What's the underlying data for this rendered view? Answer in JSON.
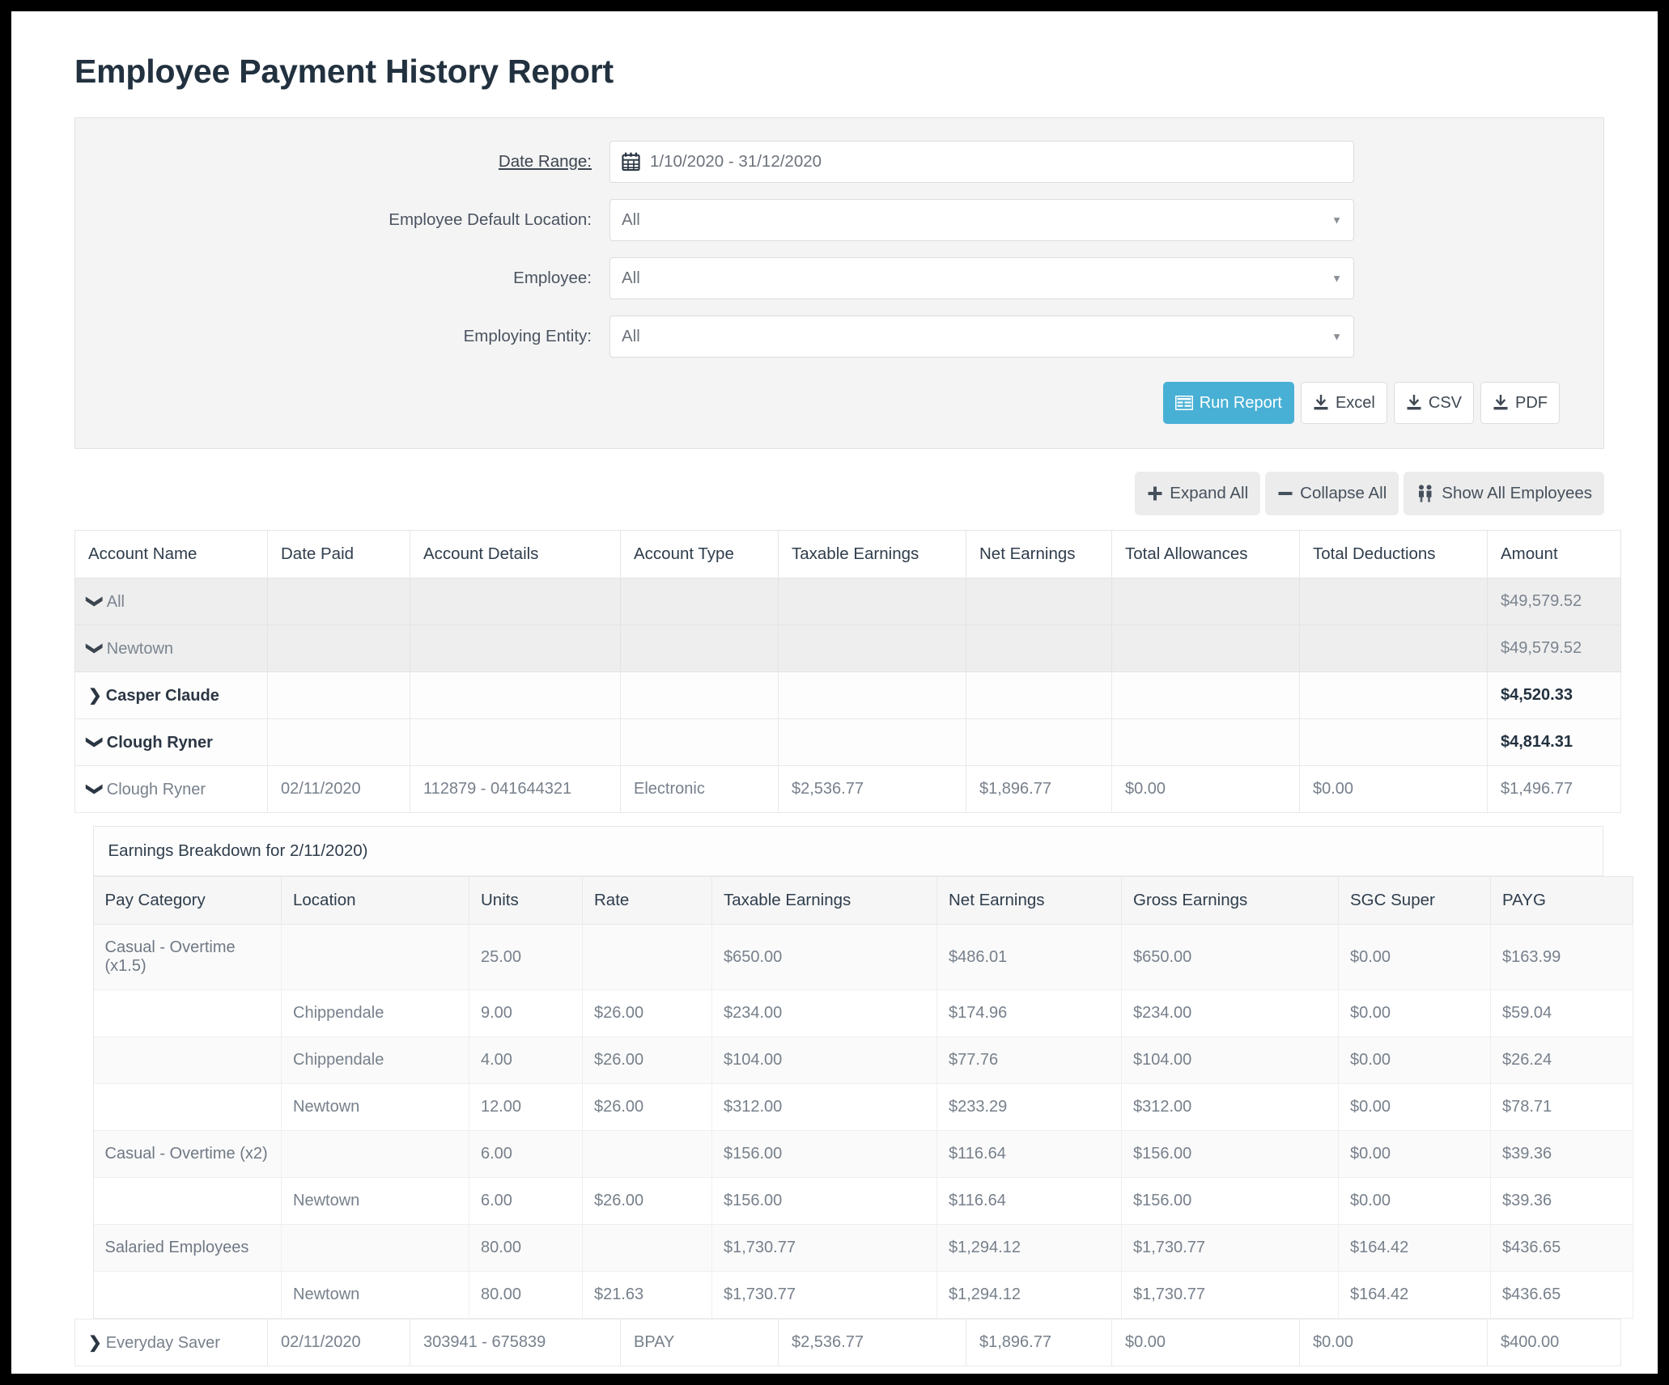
{
  "page": {
    "title": "Employee Payment History Report"
  },
  "filters": {
    "date_range": {
      "label": "Date Range:",
      "icon": "calendar-icon",
      "value": "1/10/2020 - 31/12/2020"
    },
    "employee_default_location": {
      "label": "Employee Default Location:",
      "value": "All"
    },
    "employee": {
      "label": "Employee:",
      "value": "All"
    },
    "employing_entity": {
      "label": "Employing Entity:",
      "value": "All"
    },
    "actions": {
      "run_report": "Run Report",
      "excel": "Excel",
      "csv": "CSV",
      "pdf": "PDF"
    }
  },
  "toolbar": {
    "expand_all": "Expand All",
    "collapse_all": "Collapse All",
    "show_all_employees": "Show All Employees"
  },
  "colors": {
    "accent": "#48b0d4",
    "panel_bg": "#f4f4f4",
    "group_row_bg": "#eeeeee",
    "title_text": "#22313f",
    "body_text": "#77808b"
  },
  "table": {
    "columns": [
      "Account Name",
      "Date Paid",
      "Account Details",
      "Account Type",
      "Taxable Earnings",
      "Net Earnings",
      "Total Allowances",
      "Total Deductions",
      "Amount"
    ],
    "rows": [
      {
        "level": "group-l1",
        "caret": "down",
        "name": "All",
        "date_paid": "",
        "account_details": "",
        "account_type": "",
        "taxable_earnings": "",
        "net_earnings": "",
        "total_allowances": "",
        "total_deductions": "",
        "amount": "$49,579.52"
      },
      {
        "level": "group-l2",
        "caret": "down",
        "name": "Newtown",
        "date_paid": "",
        "account_details": "",
        "account_type": "",
        "taxable_earnings": "",
        "net_earnings": "",
        "total_allowances": "",
        "total_deductions": "",
        "amount": "$49,579.52"
      },
      {
        "level": "group-l3",
        "caret": "right",
        "name": "Casper Claude",
        "date_paid": "",
        "account_details": "",
        "account_type": "",
        "taxable_earnings": "",
        "net_earnings": "",
        "total_allowances": "",
        "total_deductions": "",
        "amount": "$4,520.33"
      },
      {
        "level": "group-l3",
        "caret": "down",
        "name": "Clough Ryner",
        "date_paid": "",
        "account_details": "",
        "account_type": "",
        "taxable_earnings": "",
        "net_earnings": "",
        "total_allowances": "",
        "total_deductions": "",
        "amount": "$4,814.31"
      },
      {
        "level": "detail",
        "caret": "down",
        "name": "Clough Ryner",
        "date_paid": "02/11/2020",
        "account_details": "112879 - 041644321",
        "account_type": "Electronic",
        "taxable_earnings": "$2,536.77",
        "net_earnings": "$1,896.77",
        "total_allowances": "$0.00",
        "total_deductions": "$0.00",
        "amount": "$1,496.77"
      },
      {
        "level": "detail",
        "caret": "right",
        "name": "Everyday Saver",
        "date_paid": "02/11/2020",
        "account_details": "303941 - 675839",
        "account_type": "BPAY",
        "taxable_earnings": "$2,536.77",
        "net_earnings": "$1,896.77",
        "total_allowances": "$0.00",
        "total_deductions": "$0.00",
        "amount": "$400.00"
      }
    ]
  },
  "breakdown": {
    "title": "Earnings Breakdown for 2/11/2020)",
    "columns": [
      "Pay Category",
      "Location",
      "Units",
      "Rate",
      "Taxable Earnings",
      "Net Earnings",
      "Gross Earnings",
      "SGC Super",
      "PAYG"
    ],
    "rows": [
      {
        "pay_category": "Casual - Overtime (x1.5)",
        "location": "",
        "units": "25.00",
        "rate": "",
        "taxable_earnings": "$650.00",
        "net_earnings": "$486.01",
        "gross_earnings": "$650.00",
        "sgc_super": "$0.00",
        "payg": "$163.99"
      },
      {
        "pay_category": "",
        "location": "Chippendale",
        "units": "9.00",
        "rate": "$26.00",
        "taxable_earnings": "$234.00",
        "net_earnings": "$174.96",
        "gross_earnings": "$234.00",
        "sgc_super": "$0.00",
        "payg": "$59.04"
      },
      {
        "pay_category": "",
        "location": "Chippendale",
        "units": "4.00",
        "rate": "$26.00",
        "taxable_earnings": "$104.00",
        "net_earnings": "$77.76",
        "gross_earnings": "$104.00",
        "sgc_super": "$0.00",
        "payg": "$26.24"
      },
      {
        "pay_category": "",
        "location": "Newtown",
        "units": "12.00",
        "rate": "$26.00",
        "taxable_earnings": "$312.00",
        "net_earnings": "$233.29",
        "gross_earnings": "$312.00",
        "sgc_super": "$0.00",
        "payg": "$78.71"
      },
      {
        "pay_category": "Casual - Overtime (x2)",
        "location": "",
        "units": "6.00",
        "rate": "",
        "taxable_earnings": "$156.00",
        "net_earnings": "$116.64",
        "gross_earnings": "$156.00",
        "sgc_super": "$0.00",
        "payg": "$39.36"
      },
      {
        "pay_category": "",
        "location": "Newtown",
        "units": "6.00",
        "rate": "$26.00",
        "taxable_earnings": "$156.00",
        "net_earnings": "$116.64",
        "gross_earnings": "$156.00",
        "sgc_super": "$0.00",
        "payg": "$39.36"
      },
      {
        "pay_category": "Salaried Employees",
        "location": "",
        "units": "80.00",
        "rate": "",
        "taxable_earnings": "$1,730.77",
        "net_earnings": "$1,294.12",
        "gross_earnings": "$1,730.77",
        "sgc_super": "$164.42",
        "payg": "$436.65"
      },
      {
        "pay_category": "",
        "location": "Newtown",
        "units": "80.00",
        "rate": "$21.63",
        "taxable_earnings": "$1,730.77",
        "net_earnings": "$1,294.12",
        "gross_earnings": "$1,730.77",
        "sgc_super": "$164.42",
        "payg": "$436.65"
      }
    ]
  }
}
